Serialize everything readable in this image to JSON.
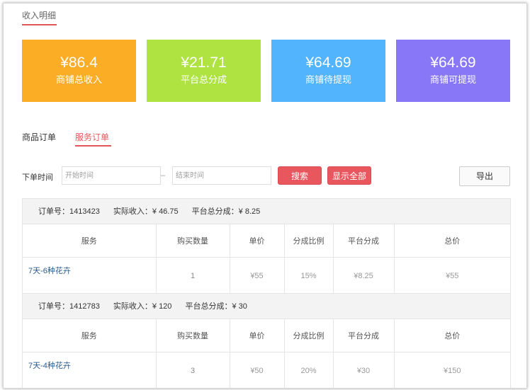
{
  "page": {
    "title": "收入明细"
  },
  "stats": [
    {
      "value": "¥86.4",
      "label": "商铺总收入",
      "color": "#fbae25"
    },
    {
      "value": "¥21.71",
      "label": "平台总分成",
      "color": "#aee342"
    },
    {
      "value": "¥64.69",
      "label": "商铺待提现",
      "color": "#52b4fc"
    },
    {
      "value": "¥64.69",
      "label": "商铺可提现",
      "color": "#8877f6"
    }
  ],
  "tabs": [
    {
      "label": "商品订单",
      "active": false
    },
    {
      "label": "服务订单",
      "active": true
    }
  ],
  "filter": {
    "label": "下单时间",
    "start_placeholder": "开始时间",
    "separator": "–",
    "end_placeholder": "结束时间",
    "search_label": "搜索",
    "show_all_label": "显示全部",
    "export_label": "导出"
  },
  "columns": [
    "服务",
    "购买数量",
    "单价",
    "分成比例",
    "平台分成",
    "总价"
  ],
  "orders": [
    {
      "order_no": "订单号：1413423",
      "actual_income": "实际收入：¥ 46.75",
      "platform_share": "平台总分成：¥ 8.25",
      "row": {
        "service": "7天-6种花卉",
        "qty": "1",
        "unit_price": "¥55",
        "ratio": "15%",
        "share": "¥8.25",
        "total": "¥55"
      }
    },
    {
      "order_no": "订单号：1412783",
      "actual_income": "实际收入：¥ 120",
      "platform_share": "平台总分成：¥ 30",
      "row": {
        "service": "7天-4种花卉",
        "qty": "3",
        "unit_price": "¥50",
        "ratio": "20%",
        "share": "¥30",
        "total": "¥150"
      }
    }
  ]
}
